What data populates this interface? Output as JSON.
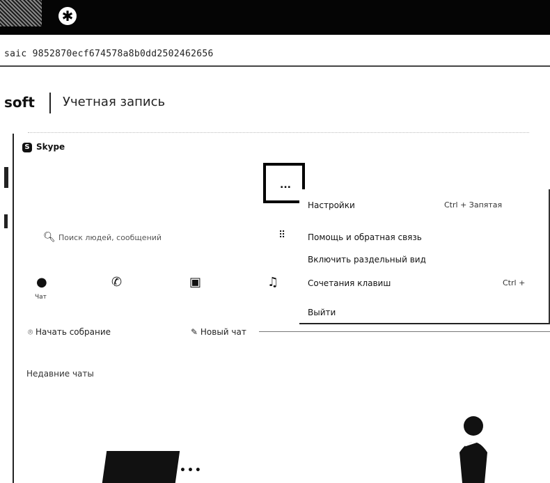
{
  "browser": {
    "url_text": "saic 9852870ecf674578a8b0dd2502462656"
  },
  "header": {
    "brand": "soft",
    "account_title": "Учетная запись"
  },
  "skype": {
    "app_title": "Skype",
    "more_button": "...",
    "search_placeholder": "Поиск людей, сообщений",
    "nav": {
      "chat_label": "Чат"
    },
    "actions": {
      "meet_now": "Начать собрание",
      "new_chat": "Новый чат"
    },
    "recent_chats": "Недавние чаты",
    "menu": {
      "items": [
        {
          "label": "Настройки",
          "shortcut": "Ctrl + Запятая"
        },
        {
          "label": "Помощь и обратная связь",
          "shortcut": ""
        },
        {
          "label": "Включить раздельный вид",
          "shortcut": ""
        },
        {
          "label": "Сочетания клавиш",
          "shortcut": "Ctrl +"
        },
        {
          "label": "Выйти",
          "shortcut": ""
        }
      ]
    }
  },
  "icons": {
    "search": "search-icon",
    "dialpad": "dialpad-icon",
    "chat": "chat-icon",
    "calls": "phone-icon",
    "contacts": "contacts-icon",
    "notifications": "bell-icon",
    "meet": "camera-icon",
    "new_chat": "compose-icon"
  }
}
